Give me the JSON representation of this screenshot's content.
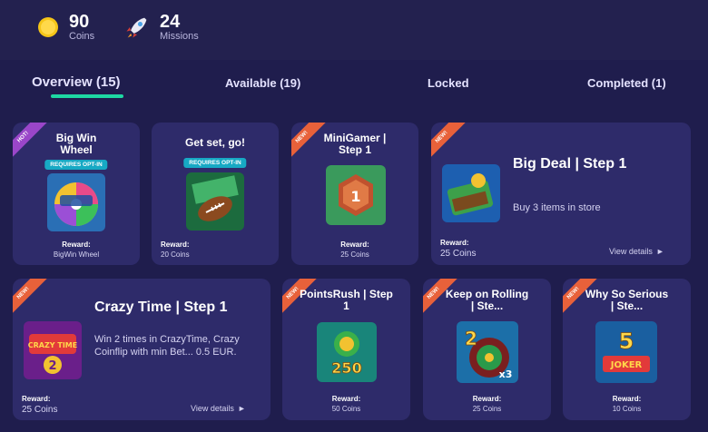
{
  "stats": {
    "coins": {
      "value": "90",
      "label": "Coins",
      "icon": "coin-icon"
    },
    "missions": {
      "value": "24",
      "label": "Missions",
      "icon": "rocket-icon"
    }
  },
  "tabs": [
    {
      "label": "Overview (15)",
      "active": true
    },
    {
      "label": "Available (19)",
      "active": false
    },
    {
      "label": "Locked",
      "active": false
    },
    {
      "label": "Completed (1)",
      "active": false
    }
  ],
  "reward_label": "Reward:",
  "details_label": "View details",
  "ribbons": {
    "hot": "HOT!",
    "new": "NEW!"
  },
  "cards": [
    {
      "title": "Big Win Wheel",
      "badge": "REQUIRES OPT-IN",
      "reward": "BigWin Wheel"
    },
    {
      "title": "Get set, go!",
      "badge": "REQUIRES OPT-IN",
      "reward": "20 Coins"
    },
    {
      "title": "MiniGamer | Step 1",
      "reward": "25 Coins",
      "thumb_text": "1"
    },
    {
      "title": "Big Deal | Step 1",
      "description": "Buy 3 items in store",
      "reward": "25 Coins"
    },
    {
      "title": "Crazy Time | Step 1",
      "description": "Win 2 times in CrazyTime, Crazy Coinflip with min Bet... 0.5 EUR.",
      "reward": "25 Coins",
      "thumb_text": "CRAZY TIME",
      "thumb_num": "2"
    },
    {
      "title": "PointsRush | Step 1",
      "reward": "50 Coins",
      "thumb_text": "250"
    },
    {
      "title": "Keep on Rolling | Ste...",
      "reward": "25 Coins",
      "thumb_text": "2",
      "thumb_sub": "x3"
    },
    {
      "title": "Why So Serious | Ste...",
      "reward": "10 Coins",
      "thumb_text": "5",
      "thumb_sub": "JOKER"
    }
  ],
  "colors": {
    "accent": "#1ed8a3",
    "card": "#2e2b6a",
    "bg": "#1f1d4d",
    "badge": "#17a9c4"
  }
}
